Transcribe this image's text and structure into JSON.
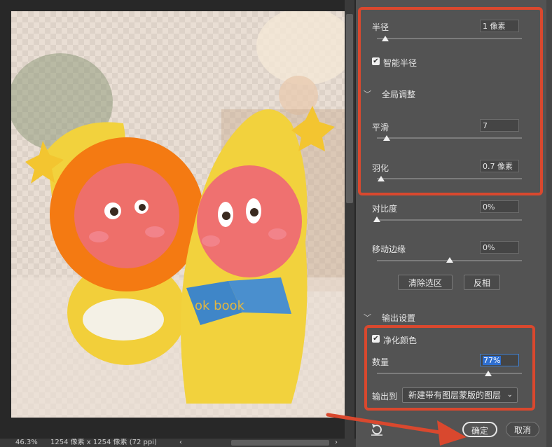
{
  "status_bar": {
    "zoom": "46.3%",
    "dimensions": "1254 像素 x 1254 像素 (72 ppi)",
    "nav_left": "‹",
    "nav_right": "›"
  },
  "photo": {
    "book_text": "ok book"
  },
  "refine": {
    "radius": {
      "label": "半径",
      "value": "1 像素",
      "level": 0.06
    },
    "smart_radius": {
      "label": "智能半径",
      "checked": true
    },
    "global_section": {
      "label": "全局调整"
    },
    "smooth": {
      "label": "平滑",
      "value": "7",
      "level": 0.07
    },
    "feather": {
      "label": "羽化",
      "value": "0.7 像素",
      "level": 0.03
    },
    "contrast": {
      "label": "对比度",
      "value": "0%",
      "level": 0.0
    },
    "shift_edge": {
      "label": "移动边缘",
      "value": "0%",
      "level": 0.5
    },
    "clear_selection_label": "清除选区",
    "invert_label": "反相",
    "output_section": {
      "label": "输出设置"
    },
    "decontaminate": {
      "label": "净化颜色",
      "checked": true
    },
    "amount": {
      "label": "数量",
      "value": "77%",
      "level": 0.77
    },
    "output_to": {
      "label": "输出到",
      "selected": "新建带有图层蒙版的图层"
    },
    "ok_label": "确定",
    "cancel_label": "取消"
  },
  "icons": {
    "reset": "reset-icon",
    "chevron": "chevron-down-icon",
    "check": "checkmark-icon"
  },
  "colors": {
    "highlight": "#d9482e",
    "panel": "#535353",
    "selection": "#2f6fd0"
  }
}
